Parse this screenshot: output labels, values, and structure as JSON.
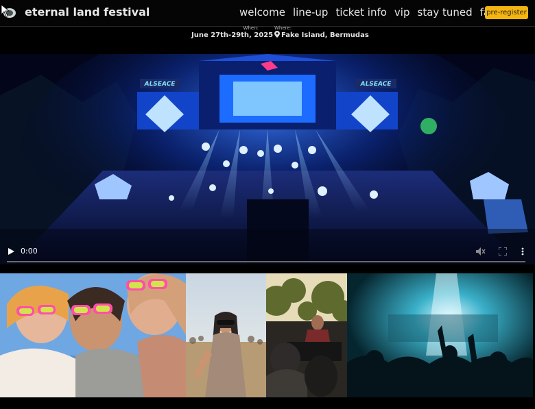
{
  "header": {
    "brand": "eternal land festival",
    "nav": [
      "welcome",
      "line-up",
      "ticket info",
      "vip",
      "stay tuned",
      "faq"
    ],
    "cta": "pre-register"
  },
  "event": {
    "when_label": "When:",
    "when_value": "June 27th-29th, 2025",
    "where_label": "Where:",
    "where_value": "Fake Island, Bermudas"
  },
  "video": {
    "time": "0:00",
    "progress": 0,
    "stage_signs": [
      "ALSEACE",
      "ALSEACE"
    ]
  },
  "gallery": {
    "photos": [
      "friends-pink-sunglasses",
      "festival-dancer",
      "dj-booth",
      "concert-crowd"
    ]
  },
  "colors": {
    "accent": "#f5b50f",
    "background": "#000000",
    "stage_blue": "#1f6bff"
  }
}
